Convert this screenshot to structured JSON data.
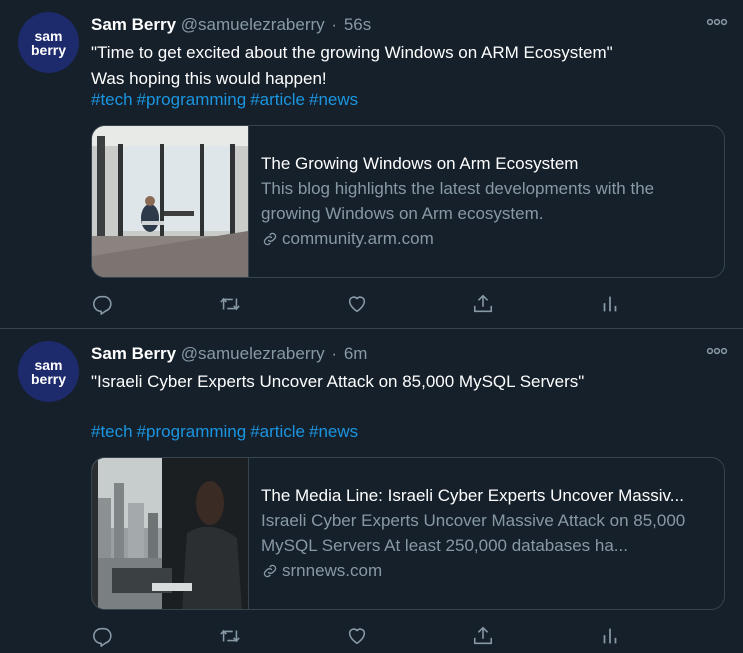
{
  "tweets": [
    {
      "avatar": {
        "line1": "sam",
        "line2": "berry"
      },
      "author": {
        "name": "Sam Berry",
        "handle": "@samuelezraberry",
        "time": "56s"
      },
      "text": "\"Time to get excited about the growing Windows on ARM Ecosystem\"\nWas hoping this would happen!",
      "hashtags": [
        "#tech",
        "#programming",
        "#article",
        "#news"
      ],
      "card": {
        "title": "The Growing Windows on Arm Ecosystem",
        "description": "This blog highlights the latest developments with the growing Windows on Arm ecosystem.",
        "domain": "community.arm.com"
      },
      "actions": [
        "reply-icon",
        "retweet-icon",
        "like-icon",
        "share-icon",
        "analytics-icon"
      ]
    },
    {
      "avatar": {
        "line1": "sam",
        "line2": "berry"
      },
      "author": {
        "name": "Sam Berry",
        "handle": "@samuelezraberry",
        "time": "6m"
      },
      "text": "\"Israeli Cyber Experts Uncover Attack on 85,000 MySQL Servers\"",
      "hashtags": [
        "#tech",
        "#programming",
        "#article",
        "#news"
      ],
      "card": {
        "title": "The Media Line: Israeli Cyber Experts Uncover Massiv...",
        "description": "Israeli Cyber Experts Uncover Massive Attack on 85,000 MySQL Servers At least 250,000 databases ha...",
        "domain": "srnnews.com"
      },
      "actions": [
        "reply-icon",
        "retweet-icon",
        "like-icon",
        "share-icon",
        "analytics-icon"
      ]
    }
  ],
  "colors": {
    "background": "#15202b",
    "border": "#38444d",
    "link": "#1b95e0",
    "secondary_text": "#8899a6",
    "avatar_bg": "#1d2a6b"
  }
}
